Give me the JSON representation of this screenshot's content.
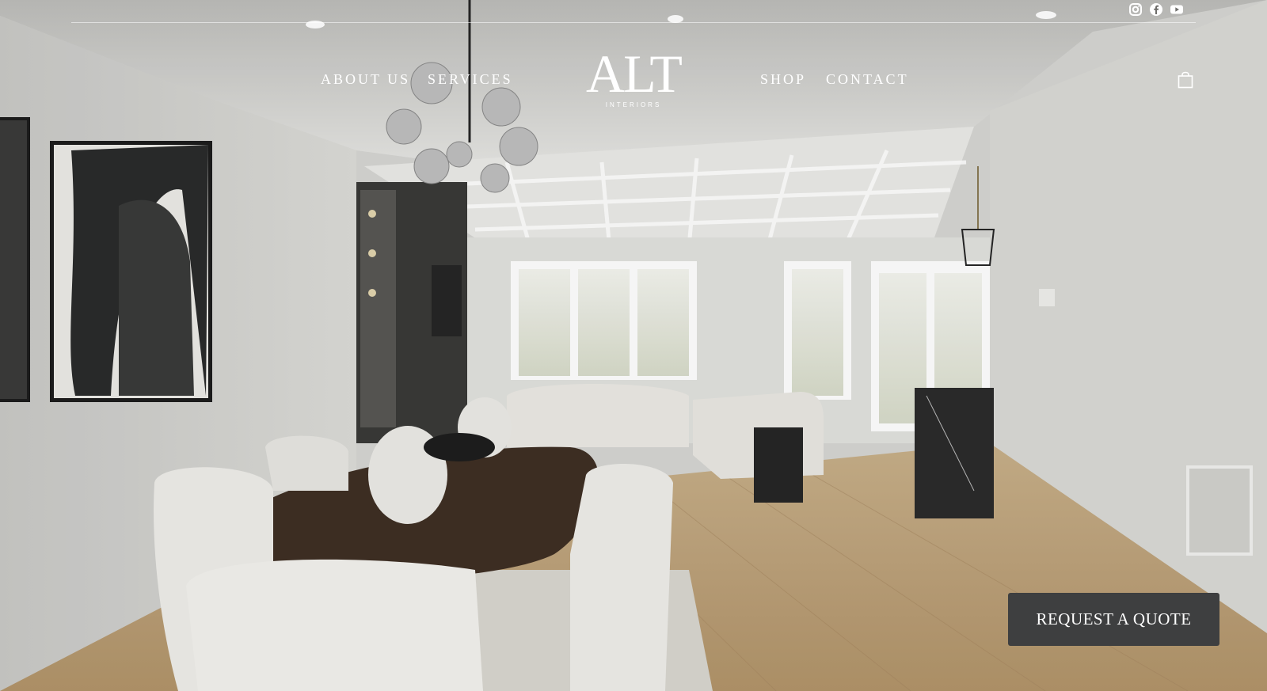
{
  "header": {
    "nav_left": [
      {
        "label": "ABOUT US"
      },
      {
        "label": "SERVICES"
      }
    ],
    "nav_right": [
      {
        "label": "SHOP"
      },
      {
        "label": "CONTACT"
      }
    ],
    "logo": {
      "main": "ALT",
      "sub": "INTERIORS"
    },
    "social_icons": [
      "instagram-icon",
      "facebook-icon",
      "youtube-icon"
    ],
    "cart_icon": "shopping-bag-icon"
  },
  "hero": {
    "image": "interior-dining-living-room-photo",
    "cta_label": "REQUEST A QUOTE"
  },
  "colors": {
    "button_bg": "#3e3f40",
    "nav_text": "#ffffff"
  }
}
